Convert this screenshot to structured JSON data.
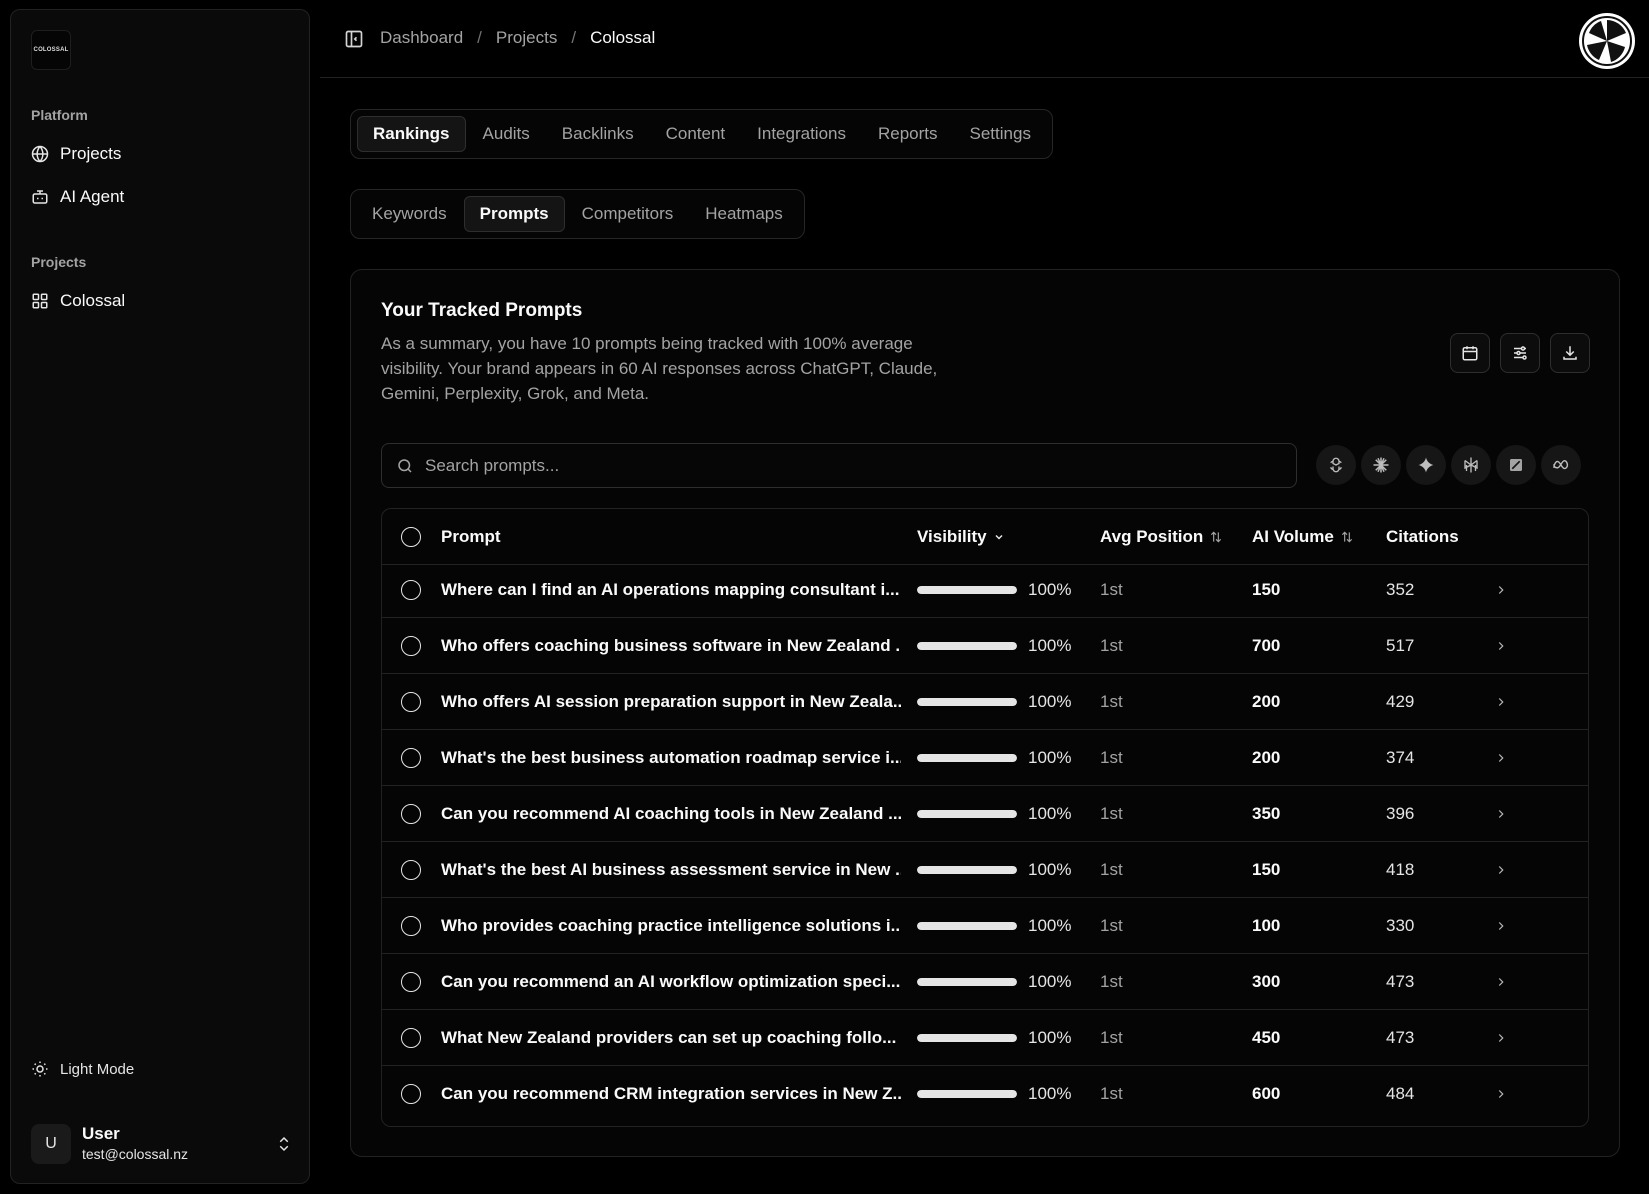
{
  "sidebar": {
    "logo_text": "COLOSSAL",
    "groups": [
      {
        "label": "Platform",
        "items": [
          {
            "label": "Projects",
            "icon": "globe-icon"
          },
          {
            "label": "AI Agent",
            "icon": "bot-icon"
          }
        ]
      },
      {
        "label": "Projects",
        "items": [
          {
            "label": "Colossal",
            "icon": "grid-icon"
          }
        ]
      }
    ],
    "light_mode_label": "Light Mode",
    "user": {
      "initial": "U",
      "name": "User",
      "email": "test@colossal.nz"
    }
  },
  "header": {
    "breadcrumb": [
      "Dashboard",
      "Projects",
      "Colossal"
    ],
    "separator": "/"
  },
  "main_tabs": [
    "Rankings",
    "Audits",
    "Backlinks",
    "Content",
    "Integrations",
    "Reports",
    "Settings"
  ],
  "main_tabs_active": "Rankings",
  "sub_tabs": [
    "Keywords",
    "Prompts",
    "Competitors",
    "Heatmaps"
  ],
  "sub_tabs_active": "Prompts",
  "card": {
    "title": "Your Tracked Prompts",
    "description": "As a summary, you have 10 prompts being tracked with 100% average visibility. Your brand appears in 60 AI responses across ChatGPT, Claude, Gemini, Perplexity, Grok, and Meta.",
    "actions": [
      "calendar-icon",
      "filter-sliders-icon",
      "download-icon"
    ]
  },
  "search": {
    "placeholder": "Search prompts..."
  },
  "model_filters": [
    "chatgpt-icon",
    "claude-icon",
    "gemini-icon",
    "perplexity-icon",
    "grok-icon",
    "meta-icon"
  ],
  "table": {
    "columns": {
      "prompt": "Prompt",
      "visibility": "Visibility",
      "avg_position": "Avg Position",
      "ai_volume": "AI Volume",
      "citations": "Citations"
    },
    "rows": [
      {
        "prompt": "Where can I find an AI operations mapping consultant i...",
        "visibility": 100,
        "visibility_label": "100%",
        "avg_position": "1st",
        "ai_volume": "150",
        "citations": "352"
      },
      {
        "prompt": "Who offers coaching business software in New Zealand ...",
        "visibility": 100,
        "visibility_label": "100%",
        "avg_position": "1st",
        "ai_volume": "700",
        "citations": "517"
      },
      {
        "prompt": "Who offers AI session preparation support in New Zeala...",
        "visibility": 100,
        "visibility_label": "100%",
        "avg_position": "1st",
        "ai_volume": "200",
        "citations": "429"
      },
      {
        "prompt": "What's the best business automation roadmap service i...",
        "visibility": 100,
        "visibility_label": "100%",
        "avg_position": "1st",
        "ai_volume": "200",
        "citations": "374"
      },
      {
        "prompt": "Can you recommend AI coaching tools in New Zealand ...",
        "visibility": 100,
        "visibility_label": "100%",
        "avg_position": "1st",
        "ai_volume": "350",
        "citations": "396"
      },
      {
        "prompt": "What's the best AI business assessment service in New ...",
        "visibility": 100,
        "visibility_label": "100%",
        "avg_position": "1st",
        "ai_volume": "150",
        "citations": "418"
      },
      {
        "prompt": "Who provides coaching practice intelligence solutions i...",
        "visibility": 100,
        "visibility_label": "100%",
        "avg_position": "1st",
        "ai_volume": "100",
        "citations": "330"
      },
      {
        "prompt": "Can you recommend an AI workflow optimization speci...",
        "visibility": 100,
        "visibility_label": "100%",
        "avg_position": "1st",
        "ai_volume": "300",
        "citations": "473"
      },
      {
        "prompt": "What New Zealand providers can set up coaching follo...",
        "visibility": 100,
        "visibility_label": "100%",
        "avg_position": "1st",
        "ai_volume": "450",
        "citations": "473"
      },
      {
        "prompt": "Can you recommend CRM integration services in New Z...",
        "visibility": 100,
        "visibility_label": "100%",
        "avg_position": "1st",
        "ai_volume": "600",
        "citations": "484"
      }
    ]
  },
  "colors": {
    "background": "#000000",
    "surface": "#0a0a0a",
    "border": "#222222",
    "text": "#fafafa",
    "muted": "#a3a3a3",
    "bar_fill": "#e5e5e5"
  }
}
